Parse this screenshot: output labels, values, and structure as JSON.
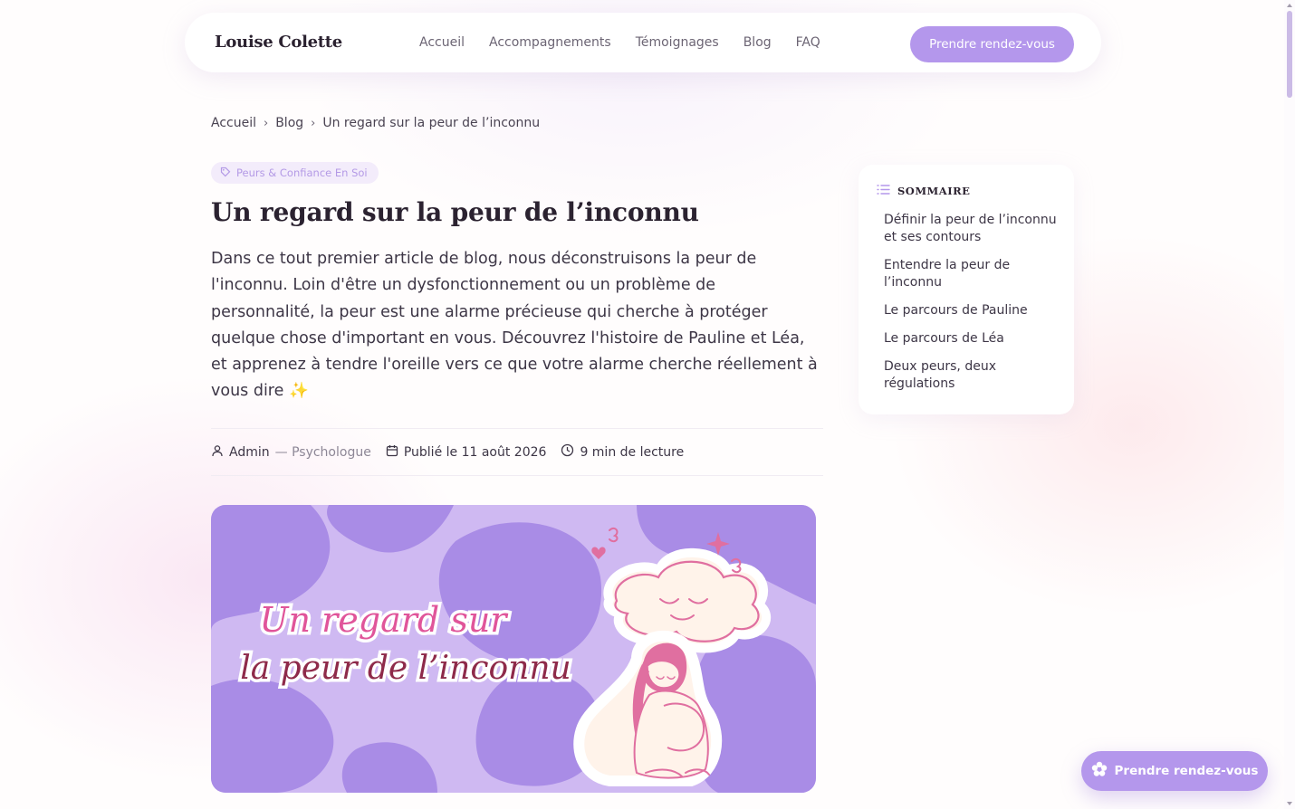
{
  "header": {
    "logo": "Louise Colette",
    "nav": [
      {
        "label": "Accueil"
      },
      {
        "label": "Accompagnements"
      },
      {
        "label": "Témoignages"
      },
      {
        "label": "Blog"
      },
      {
        "label": "FAQ"
      }
    ],
    "cta_label": "Prendre rendez-vous"
  },
  "breadcrumb": {
    "home": "Accueil",
    "blog": "Blog",
    "current": "Un regard sur la peur de l’inconnu"
  },
  "article": {
    "tag": "Peurs & Confiance En Soi",
    "title": "Un regard sur la peur de l’inconnu",
    "intro": "Dans ce tout premier article de blog, nous déconstruisons la peur de l'inconnu. Loin d'être un dysfonctionnement ou un problème de personnalité, la peur est une alarme précieuse qui cherche à protéger quelque chose d'important en vous. Découvrez l'histoire de Pauline et Léa, et apprenez à tendre l'oreille vers ce que votre alarme cherche réellement à vous dire ✨",
    "author": "Admin",
    "author_role": "— Psychologue",
    "published": "Publié le 11 août 2026",
    "reading_time": "9 min de lecture",
    "hero_line1": "Un regard sur",
    "hero_line2": "la peur de l’inconnu"
  },
  "toc": {
    "title": "SOMMAIRE",
    "items": [
      {
        "label": "Définir la peur de l’inconnu et ses contours"
      },
      {
        "label": "Entendre la peur de l’inconnu"
      },
      {
        "label": "Le parcours de Pauline"
      },
      {
        "label": "Le parcours de Léa"
      },
      {
        "label": "Deux peurs, deux régulations"
      }
    ]
  },
  "floating_cta": {
    "label": "Prendre rendez-vous",
    "icon": "flower-icon"
  },
  "icons": {
    "tag": "tag-icon",
    "author": "user-icon",
    "date": "calendar-icon",
    "time": "clock-icon",
    "toc": "list-icon",
    "breadcrumb_sep": "chevron-right-icon"
  },
  "colors": {
    "accent": "#b497ec",
    "tag_bg": "#f3ecfb",
    "tag_text": "#b49ae6",
    "hero_bg": "#cfb9f2",
    "hero_blob": "#a98ce6",
    "hero_title_line1": "#e0559a",
    "hero_title_line2": "#8e2a4a",
    "illustration_pink": "#e06fa0",
    "illustration_skin": "#fff3ea"
  }
}
